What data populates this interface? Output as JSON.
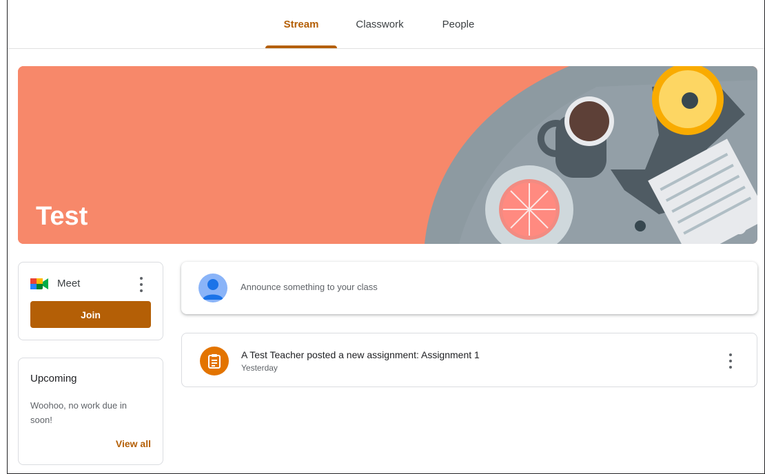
{
  "tabs": [
    {
      "label": "Stream",
      "active": true
    },
    {
      "label": "Classwork",
      "active": false
    },
    {
      "label": "People",
      "active": false
    }
  ],
  "banner": {
    "title": "Test",
    "background_color": "#f7886a",
    "info_icon": "info-icon"
  },
  "meet": {
    "label": "Meet",
    "join_label": "Join",
    "icon": "google-meet-icon",
    "menu_icon": "more-vert-icon"
  },
  "upcoming": {
    "title": "Upcoming",
    "message": "Woohoo, no work due in soon!",
    "view_all_label": "View all"
  },
  "announce": {
    "placeholder": "Announce something to your class",
    "avatar_icon": "person-icon"
  },
  "post": {
    "title": "A Test Teacher posted a new assignment: Assignment 1",
    "time": "Yesterday",
    "icon": "assignment-icon",
    "menu_icon": "more-vert-icon"
  },
  "colors": {
    "accent": "#b45f06",
    "assignment_icon_bg": "#e37400",
    "avatar_bg": "#8ab4f8"
  }
}
